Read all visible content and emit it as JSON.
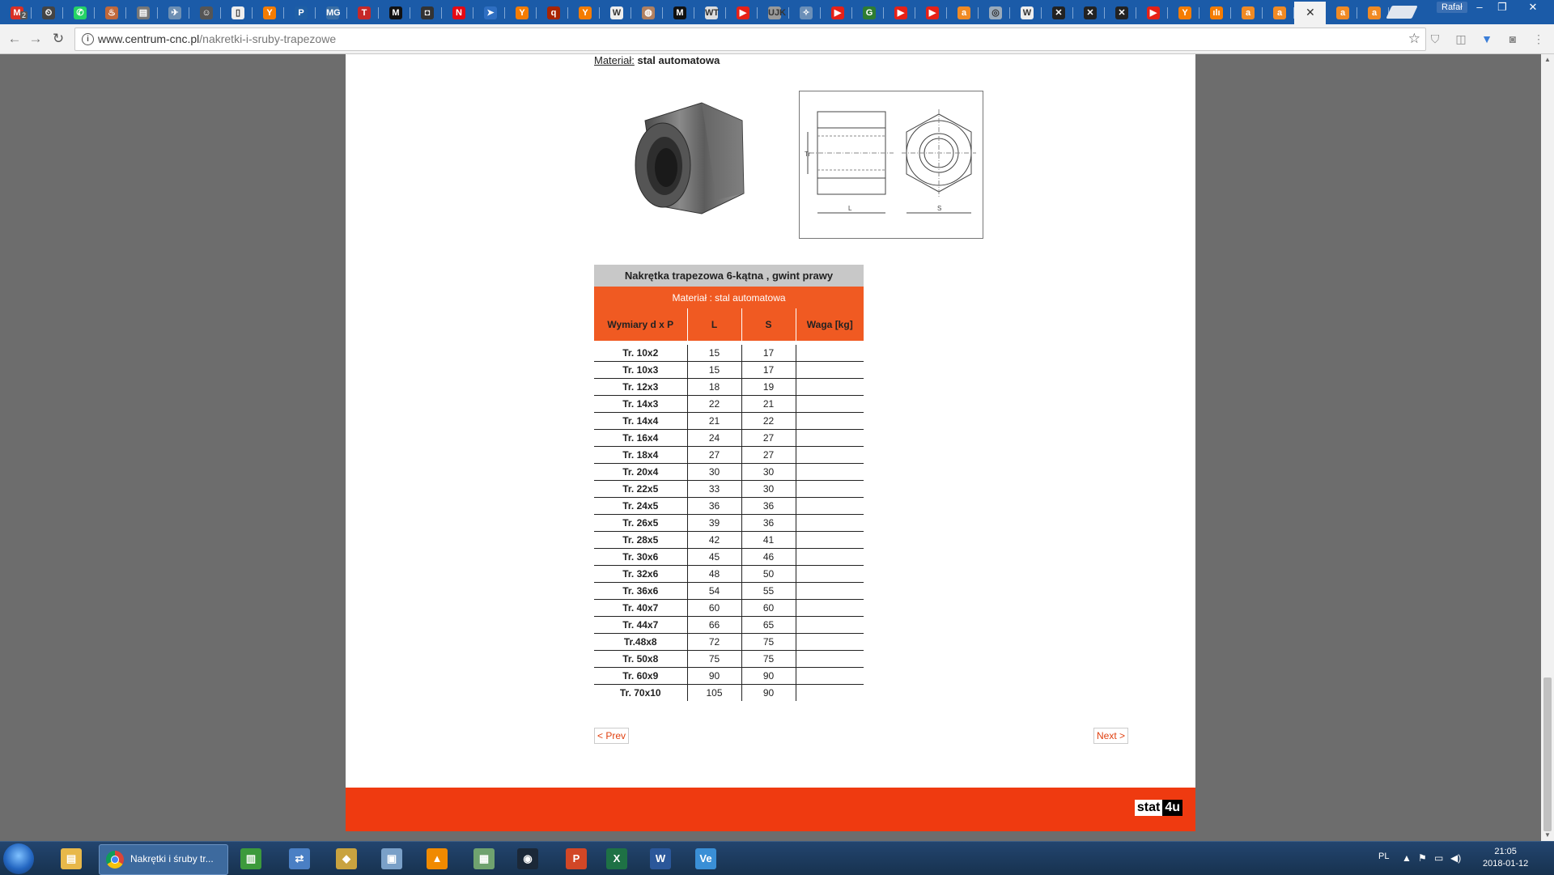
{
  "browser": {
    "tabs": [
      {
        "icon": "gmail-icon",
        "glyph": "M",
        "color": "#d93025",
        "badge": "2"
      },
      {
        "icon": "clock-icon",
        "glyph": "⏲",
        "color": "#444"
      },
      {
        "icon": "whatsapp-icon",
        "glyph": "✆",
        "color": "#25d366"
      },
      {
        "icon": "page-icon",
        "glyph": "♨",
        "color": "#c0683b"
      },
      {
        "icon": "news-icon",
        "glyph": "▤",
        "color": "#777"
      },
      {
        "icon": "plane-icon",
        "glyph": "✈",
        "color": "#6d8fb3"
      },
      {
        "icon": "person-icon",
        "glyph": "☺",
        "color": "#555"
      },
      {
        "icon": "doc-icon",
        "glyph": "▯",
        "color": "#eee"
      },
      {
        "icon": "y-icon",
        "glyph": "Y",
        "color": "#f57c00"
      },
      {
        "icon": "pnas-icon",
        "glyph": "P",
        "color": "#1f5fa5"
      },
      {
        "icon": "mg-icon",
        "glyph": "MG",
        "color": "#3a6ea5"
      },
      {
        "icon": "t-icon",
        "glyph": "T",
        "color": "#c62828"
      },
      {
        "icon": "m-icon",
        "glyph": "M",
        "color": "#111"
      },
      {
        "icon": "camera-icon",
        "glyph": "◘",
        "color": "#333"
      },
      {
        "icon": "netflix-icon",
        "glyph": "N",
        "color": "#e50914"
      },
      {
        "icon": "arrow-icon",
        "glyph": "➤",
        "color": "#2f6fc2"
      },
      {
        "icon": "y-icon",
        "glyph": "Y",
        "color": "#f57c00"
      },
      {
        "icon": "quora-icon",
        "glyph": "q",
        "color": "#a82400"
      },
      {
        "icon": "y-icon",
        "glyph": "Y",
        "color": "#f57c00"
      },
      {
        "icon": "wikipedia-icon",
        "glyph": "W",
        "color": "#eee"
      },
      {
        "icon": "bag-icon",
        "glyph": "◍",
        "color": "#b08060"
      },
      {
        "icon": "m-icon",
        "glyph": "M",
        "color": "#111"
      },
      {
        "icon": "wt-icon",
        "glyph": "WT",
        "color": "#ddd"
      },
      {
        "icon": "youtube-icon",
        "glyph": "▶",
        "color": "#e62117"
      },
      {
        "icon": "ujk-icon",
        "glyph": "UJK",
        "color": "#999"
      },
      {
        "icon": "compass-icon",
        "glyph": "✧",
        "color": "#6b8fb8"
      },
      {
        "icon": "youtube-icon",
        "glyph": "▶",
        "color": "#e62117"
      },
      {
        "icon": "g-icon",
        "glyph": "G",
        "color": "#2e7d32"
      },
      {
        "icon": "youtube-icon",
        "glyph": "▶",
        "color": "#e62117"
      },
      {
        "icon": "youtube-icon",
        "glyph": "▶",
        "color": "#e62117"
      },
      {
        "icon": "amazon-icon",
        "glyph": "a",
        "color": "#f08a24"
      },
      {
        "icon": "search-icon",
        "glyph": "◎",
        "color": "#9ab"
      },
      {
        "icon": "wikipedia-icon",
        "glyph": "W",
        "color": "#eee"
      },
      {
        "icon": "x-icon",
        "glyph": "✕",
        "color": "#222"
      },
      {
        "icon": "x-icon",
        "glyph": "✕",
        "color": "#222"
      },
      {
        "icon": "x-icon",
        "glyph": "✕",
        "color": "#222"
      },
      {
        "icon": "youtube-icon",
        "glyph": "▶",
        "color": "#e62117"
      },
      {
        "icon": "y-icon",
        "glyph": "Y",
        "color": "#f57c00"
      },
      {
        "icon": "chart-icon",
        "glyph": "ılı",
        "color": "#f57c00"
      },
      {
        "icon": "amazon-icon",
        "glyph": "a",
        "color": "#f08a24"
      },
      {
        "icon": "amazon-icon",
        "glyph": "a",
        "color": "#f08a24"
      },
      {
        "icon": "close-icon",
        "glyph": "✕",
        "color": "#333",
        "active": true
      },
      {
        "icon": "amazon-icon",
        "glyph": "a",
        "color": "#f08a24"
      },
      {
        "icon": "amazon-icon",
        "glyph": "a",
        "color": "#f08a24"
      }
    ],
    "profile": "Rafał",
    "url_host": "www.centrum-cnc.pl",
    "url_path": "/nakretki-i-sruby-trapezowe"
  },
  "page": {
    "material_label": "Materiał:",
    "material_value": "stal automatowa",
    "table": {
      "title": "Nakrętka trapezowa 6-kątna , gwint prawy",
      "material": "Materiał : stal automatowa",
      "headers": [
        "Wymiary d x P",
        "L",
        "S",
        "Waga [kg]"
      ],
      "rows": [
        [
          "Tr. 10x2",
          "15",
          "17",
          ""
        ],
        [
          "Tr. 10x3",
          "15",
          "17",
          ""
        ],
        [
          "Tr. 12x3",
          "18",
          "19",
          ""
        ],
        [
          "Tr. 14x3",
          "22",
          "21",
          ""
        ],
        [
          "Tr. 14x4",
          "21",
          "22",
          ""
        ],
        [
          "Tr. 16x4",
          "24",
          "27",
          ""
        ],
        [
          "Tr. 18x4",
          "27",
          "27",
          ""
        ],
        [
          "Tr. 20x4",
          "30",
          "30",
          ""
        ],
        [
          "Tr. 22x5",
          "33",
          "30",
          ""
        ],
        [
          "Tr. 24x5",
          "36",
          "36",
          ""
        ],
        [
          "Tr. 26x5",
          "39",
          "36",
          ""
        ],
        [
          "Tr. 28x5",
          "42",
          "41",
          ""
        ],
        [
          "Tr. 30x6",
          "45",
          "46",
          ""
        ],
        [
          "Tr. 32x6",
          "48",
          "50",
          ""
        ],
        [
          "Tr. 36x6",
          "54",
          "55",
          ""
        ],
        [
          "Tr. 40x7",
          "60",
          "60",
          ""
        ],
        [
          "Tr. 44x7",
          "66",
          "65",
          ""
        ],
        [
          "Tr.48x8",
          "72",
          "75",
          ""
        ],
        [
          "Tr. 50x8",
          "75",
          "75",
          ""
        ],
        [
          "Tr. 60x9",
          "90",
          "90",
          ""
        ],
        [
          "Tr. 70x10",
          "105",
          "90",
          ""
        ]
      ]
    },
    "drawing_labels": {
      "tr": "Tr",
      "l": "L",
      "s": "S"
    },
    "prev_label": "< Prev",
    "next_label": "Next >",
    "footer_badge_a": "stat",
    "footer_badge_b": "4u"
  },
  "taskbar": {
    "chrome_label": "Nakrętki i śruby tr...",
    "apps": [
      {
        "name": "explorer-icon",
        "glyph": "▤",
        "color": "#e8b84a"
      },
      {
        "name": "notepad-chart-icon",
        "glyph": "▥",
        "color": "#3c9a3c"
      },
      {
        "name": "network-icon",
        "glyph": "⇄",
        "color": "#4a7fc4"
      },
      {
        "name": "diamond-app-icon",
        "glyph": "◆",
        "color": "#c9a340"
      },
      {
        "name": "virtualbox-icon",
        "glyph": "▣",
        "color": "#7aa0c8"
      },
      {
        "name": "vlc-icon",
        "glyph": "▲",
        "color": "#f08a00"
      },
      {
        "name": "device-icon",
        "glyph": "▦",
        "color": "#6fa26f"
      },
      {
        "name": "steam-icon",
        "glyph": "◉",
        "color": "#1b2838"
      },
      {
        "name": "powerpoint-icon",
        "glyph": "P",
        "color": "#d24726"
      },
      {
        "name": "excel-icon",
        "glyph": "X",
        "color": "#1e7145"
      },
      {
        "name": "word-icon",
        "glyph": "W",
        "color": "#2b579a"
      },
      {
        "name": "visio-icon",
        "glyph": "Ve",
        "color": "#3a8fd6"
      }
    ],
    "lang": "PL",
    "time": "21:05",
    "date": "2018-01-12"
  }
}
